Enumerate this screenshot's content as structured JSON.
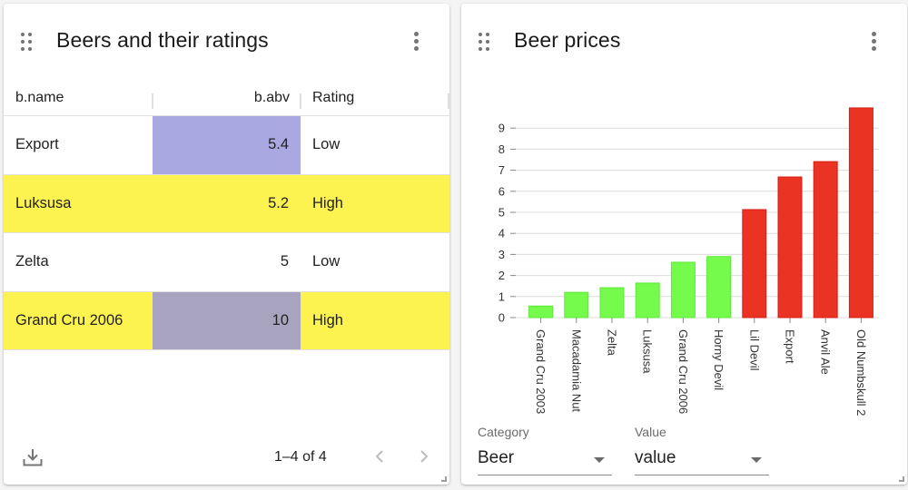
{
  "left_card": {
    "title": "Beers and their ratings",
    "icons": {
      "drag": "drag-handle-icon",
      "menu": "more-vert-icon",
      "download": "download-icon",
      "prev": "chevron-left-icon",
      "next": "chevron-right-icon"
    },
    "columns": [
      "b.name",
      "b.abv",
      "Rating"
    ],
    "rows": [
      {
        "name": "Export",
        "abv": "5.4",
        "rating": "Low",
        "row_color": "#ffffff",
        "abv_color": "#a9a8e1"
      },
      {
        "name": "Luksusa",
        "abv": "5.2",
        "rating": "High",
        "row_color": "#fdf350",
        "abv_color": "#fdf350"
      },
      {
        "name": "Zelta",
        "abv": "5",
        "rating": "Low",
        "row_color": "#ffffff",
        "abv_color": "#ffffff"
      },
      {
        "name": "Grand Cru 2006",
        "abv": "10",
        "rating": "High",
        "row_color": "#fdf350",
        "abv_color": "#a8a4c0"
      }
    ],
    "pagination": "1–4 of 4"
  },
  "right_card": {
    "title": "Beer prices",
    "icons": {
      "drag": "drag-handle-icon",
      "menu": "more-vert-icon"
    },
    "category_select": {
      "label": "Category",
      "value": "Beer"
    },
    "value_select": {
      "label": "Value",
      "value": "value"
    }
  },
  "chart_data": {
    "type": "bar",
    "title": "Beer prices",
    "xlabel": "",
    "ylabel": "",
    "categories": [
      "Grand Cru 2003",
      "Macadamia Nut",
      "Zelta",
      "Luksusa",
      "Grand Cru 2006",
      "Horny Devil",
      "Lil Devil",
      "Export",
      "Anvil Ale",
      "Old Numbskull 2"
    ],
    "values": [
      0.55,
      1.2,
      1.42,
      1.64,
      2.63,
      2.9,
      5.13,
      6.68,
      7.41,
      9.96
    ],
    "colors": [
      "#75fb4c",
      "#75fb4c",
      "#75fb4c",
      "#75fb4c",
      "#75fb4c",
      "#75fb4c",
      "#ea3323",
      "#ea3323",
      "#ea3323",
      "#ea3323"
    ],
    "yticks": [
      0,
      1,
      2,
      3,
      4,
      5,
      6,
      7,
      8,
      9
    ],
    "ylim": [
      0,
      10
    ],
    "grid": true,
    "legend": "none"
  }
}
